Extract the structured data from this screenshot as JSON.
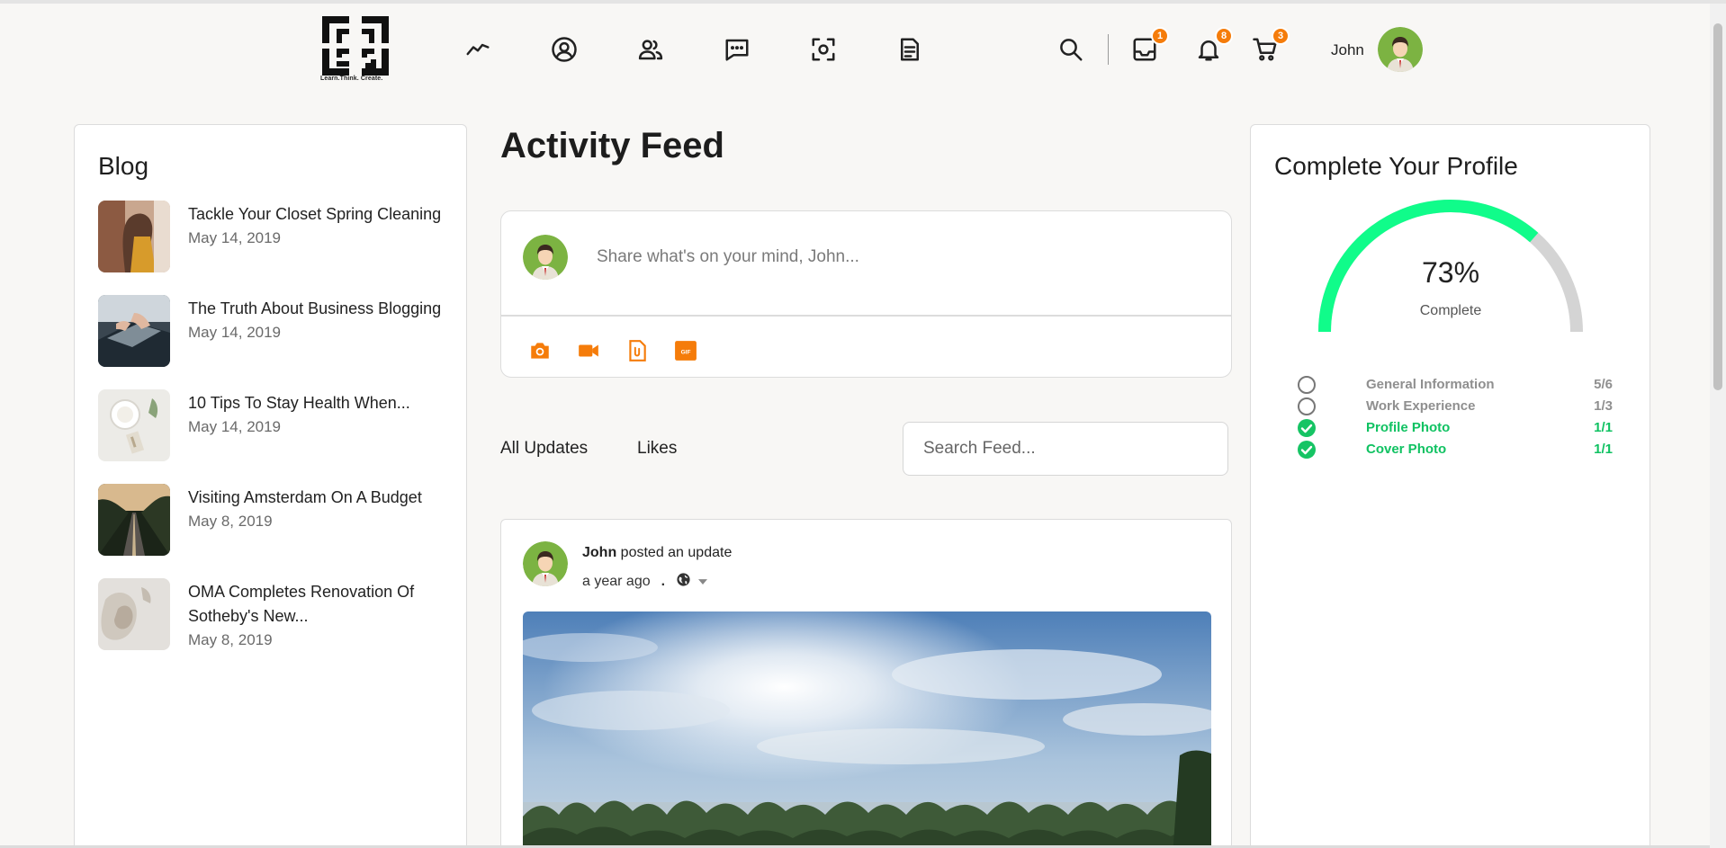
{
  "header": {
    "logo_tagline": "Learn.Think. Create.",
    "nav_icons": [
      "activity-icon",
      "profile-icon",
      "members-icon",
      "messages-icon",
      "photos-icon",
      "documents-icon"
    ],
    "badges": {
      "inbox": "1",
      "notifications": "8",
      "cart": "3"
    },
    "user_name": "John"
  },
  "blog": {
    "title": "Blog",
    "items": [
      {
        "title": "Tackle Your Closet Spring Cleaning",
        "date": "May 14, 2019"
      },
      {
        "title": "The Truth About Business Blogging",
        "date": "May 14, 2019"
      },
      {
        "title": "10 Tips To Stay Health When...",
        "date": "May 14, 2019"
      },
      {
        "title": "Visiting Amsterdam On A Budget",
        "date": "May 8, 2019"
      },
      {
        "title": "OMA Completes Renovation Of Sotheby's New...",
        "date": "May 8, 2019"
      }
    ]
  },
  "feed": {
    "title": "Activity Feed",
    "composer_placeholder": "Share what's on your mind, John...",
    "composer_actions": [
      "camera-icon",
      "video-icon",
      "attachment-icon",
      "gif-icon"
    ],
    "tabs": [
      "All Updates",
      "Likes"
    ],
    "search_placeholder": "Search Feed...",
    "post": {
      "author": "John",
      "action": "posted an update",
      "time": "a year ago",
      "separator": "."
    }
  },
  "profile": {
    "title": "Complete Your Profile",
    "percent_label": "73%",
    "percent": 73,
    "complete_label": "Complete",
    "items": [
      {
        "label": "General Information",
        "count": "5/6",
        "done": false
      },
      {
        "label": "Work Experience",
        "count": "1/3",
        "done": false
      },
      {
        "label": "Profile Photo",
        "count": "1/1",
        "done": true
      },
      {
        "label": "Cover Photo",
        "count": "1/1",
        "done": true
      }
    ]
  },
  "colors": {
    "accent": "#f57c0a",
    "progress": "#10fc8a",
    "progress_track": "#d4d4d4",
    "done": "#10c262"
  }
}
